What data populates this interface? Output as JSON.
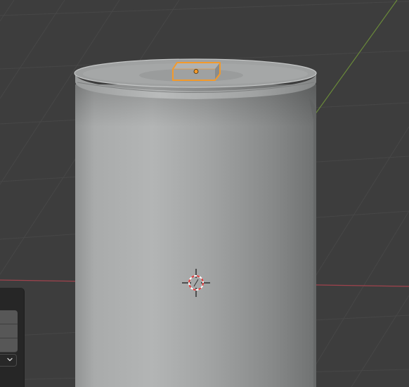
{
  "viewport": {
    "background_color": "#3d3d3d",
    "grid_line_color": "#474747",
    "x_axis_color": "#a0434d",
    "y_axis_color": "#6a8a3a"
  },
  "scene_objects": {
    "can": {
      "type": "cylinder-can",
      "body_color": "#a6a8a8",
      "state": "unselected"
    },
    "tab": {
      "type": "pull-tab",
      "state": "selected-active",
      "outline_color": "#f39a2b"
    },
    "cursor": {
      "icon": "3d-cursor-icon",
      "ring_colors": [
        "#e03a3a",
        "#ffffff"
      ]
    }
  },
  "side_panel": {
    "rows": [
      {
        "icon": "field-row"
      },
      {
        "icon": "field-row"
      },
      {
        "icon": "field-row"
      }
    ],
    "dropdown": {
      "icon": "chevron-down-icon"
    }
  }
}
